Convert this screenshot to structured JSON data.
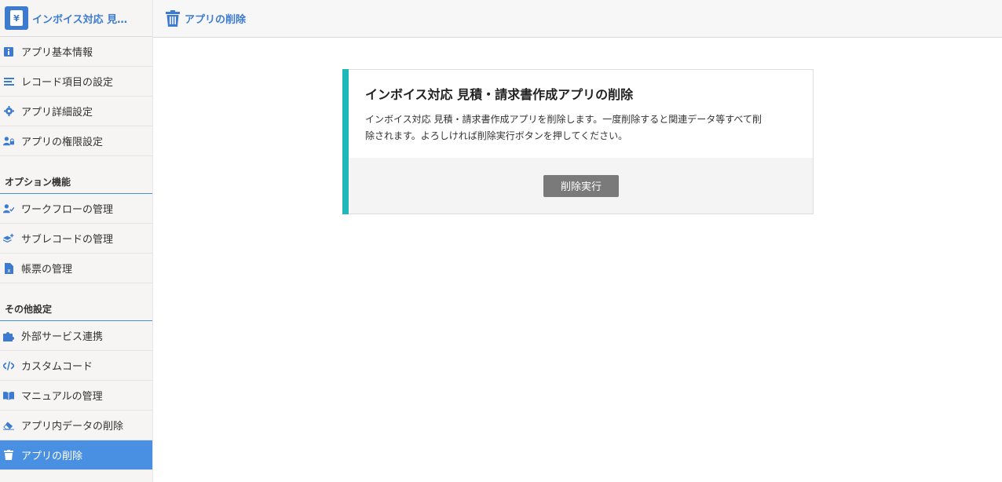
{
  "app": {
    "title": "インボイス対応 見…"
  },
  "header": {
    "title": "アプリの削除"
  },
  "sidebar": {
    "items": [
      {
        "label": "アプリ基本情報",
        "icon": "info-icon"
      },
      {
        "label": "レコード項目の設定",
        "icon": "list-icon"
      },
      {
        "label": "アプリ詳細設定",
        "icon": "gear-icon"
      },
      {
        "label": "アプリの権限設定",
        "icon": "user-lock-icon"
      }
    ],
    "sections": [
      {
        "title": "オプション機能",
        "items": [
          {
            "label": "ワークフローの管理",
            "icon": "user-check-icon"
          },
          {
            "label": "サブレコードの管理",
            "icon": "layers-plus-icon"
          },
          {
            "label": "帳票の管理",
            "icon": "excel-file-icon"
          }
        ]
      },
      {
        "title": "その他設定",
        "items": [
          {
            "label": "外部サービス連携",
            "icon": "puzzle-icon"
          },
          {
            "label": "カスタムコード",
            "icon": "code-icon"
          },
          {
            "label": "マニュアルの管理",
            "icon": "book-icon"
          },
          {
            "label": "アプリ内データの削除",
            "icon": "eraser-icon"
          },
          {
            "label": "アプリの削除",
            "icon": "trash-icon",
            "active": true
          }
        ]
      }
    ]
  },
  "card": {
    "title": "インボイス対応 見積・請求書作成アプリの削除",
    "text_line1": "インボイス対応 見積・請求書作成アプリを削除します。一度削除すると関連データ等すべて削",
    "text_line2": "除されます。よろしければ削除実行ボタンを押してください。",
    "button_label": "削除実行"
  },
  "colors": {
    "accent": "#4a90e2",
    "card_accent": "#1fb8b8",
    "button": "#7a7a7a"
  }
}
